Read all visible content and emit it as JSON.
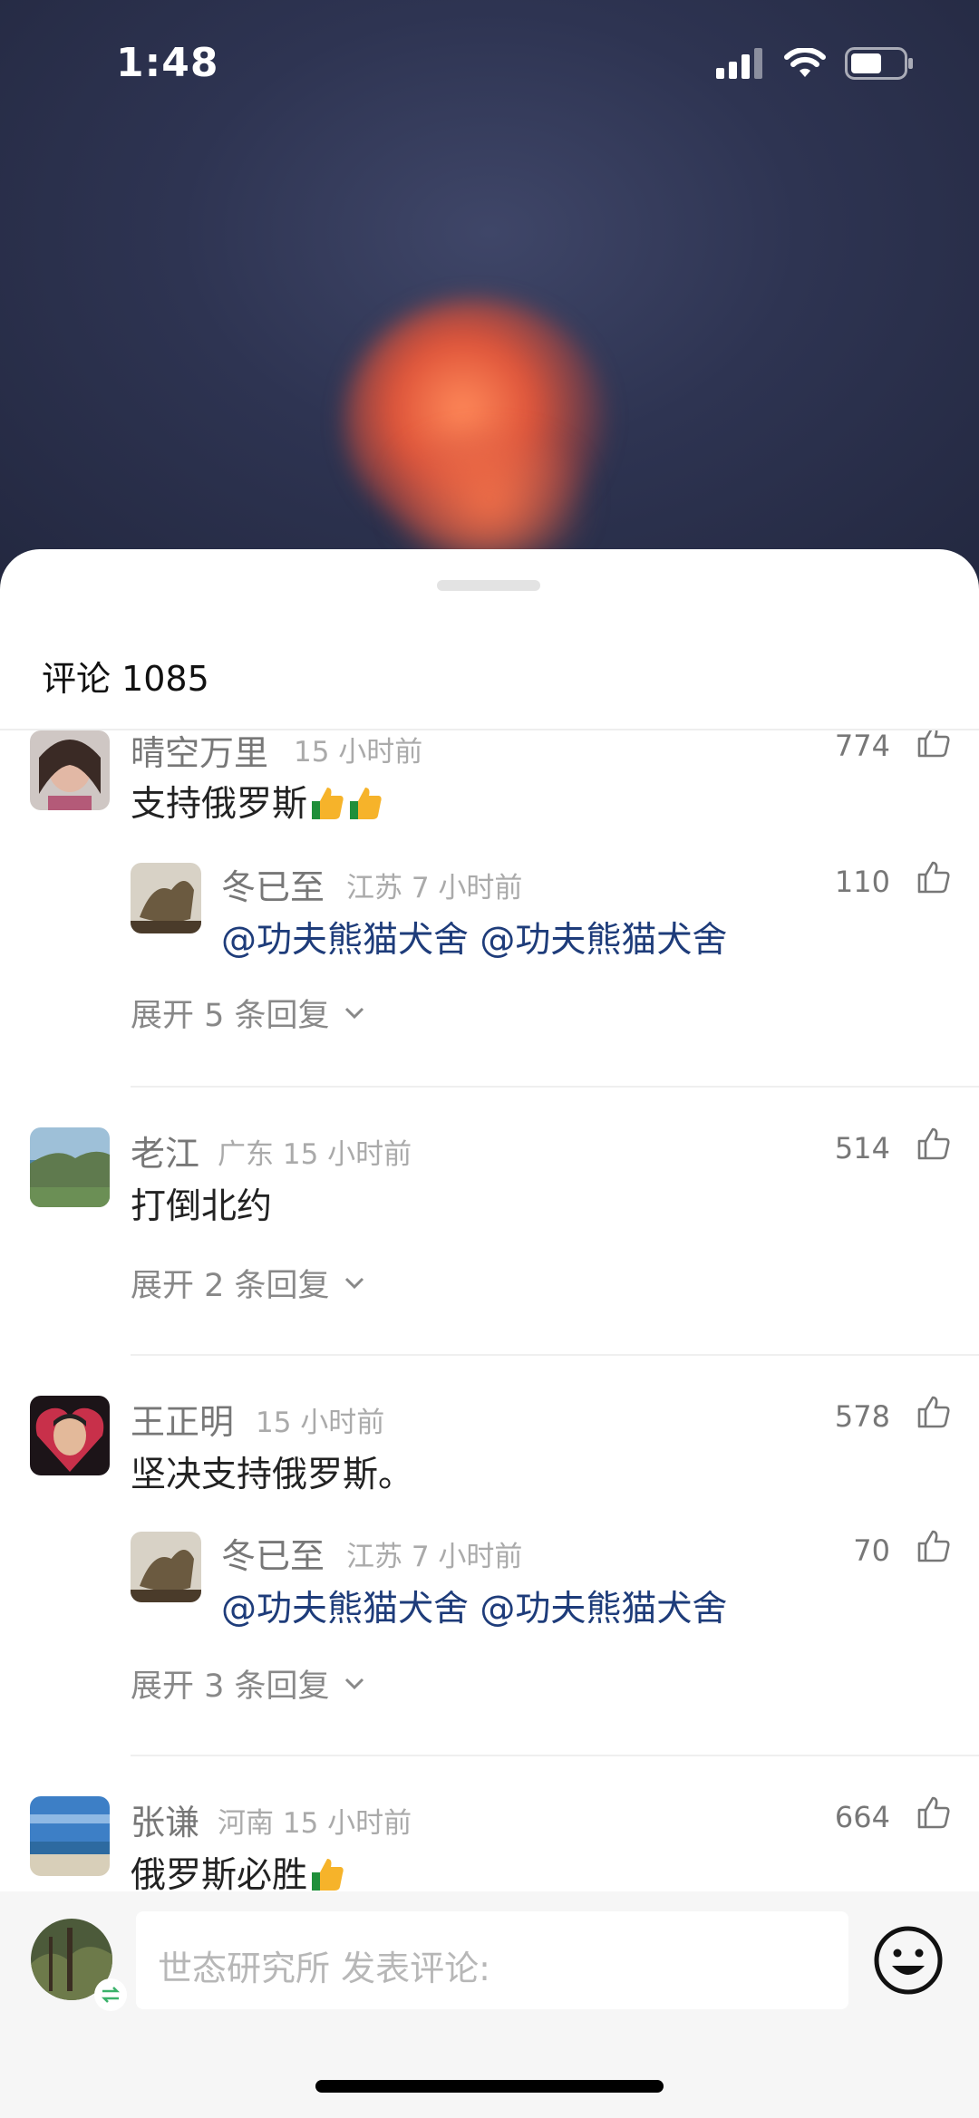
{
  "status_bar": {
    "time": "1:48"
  },
  "sheet": {
    "title": "评论 1085"
  },
  "comments": [
    {
      "name": "晴空万里",
      "meta": "15 小时前",
      "likes": "774",
      "text": "支持俄罗斯",
      "emoji": "thumbs-up x2",
      "reply": {
        "name": "冬已至",
        "meta": "江苏 7 小时前",
        "likes": "110",
        "text": "@功夫熊猫犬舍 @功夫熊猫犬舍"
      },
      "expand": "展开 5 条回复"
    },
    {
      "name": "老江",
      "meta": "广东 15 小时前",
      "likes": "514",
      "text": "打倒北约",
      "expand": "展开 2 条回复"
    },
    {
      "name": "王正明",
      "meta": "15 小时前",
      "likes": "578",
      "text": "坚决支持俄罗斯。",
      "reply": {
        "name": "冬已至",
        "meta": "江苏 7 小时前",
        "likes": "70",
        "text": "@功夫熊猫犬舍 @功夫熊猫犬舍"
      },
      "expand": "展开 3 条回复"
    },
    {
      "name": "张谦",
      "meta": "河南 15 小时前",
      "likes": "664",
      "text": "俄罗斯必胜",
      "emoji": "thumbs-up"
    }
  ],
  "composer": {
    "placeholder": "世态研究所 发表评论:"
  },
  "icons": {
    "like": "thumbs-up-outline-icon",
    "chevron": "chevron-down-icon",
    "emoji": "smiley-icon",
    "swap": "swap-account-icon"
  },
  "colors": {
    "mention": "#1e3c7a",
    "sheet_bg": "#ffffff",
    "bottom_bg": "#f6f6f6"
  }
}
